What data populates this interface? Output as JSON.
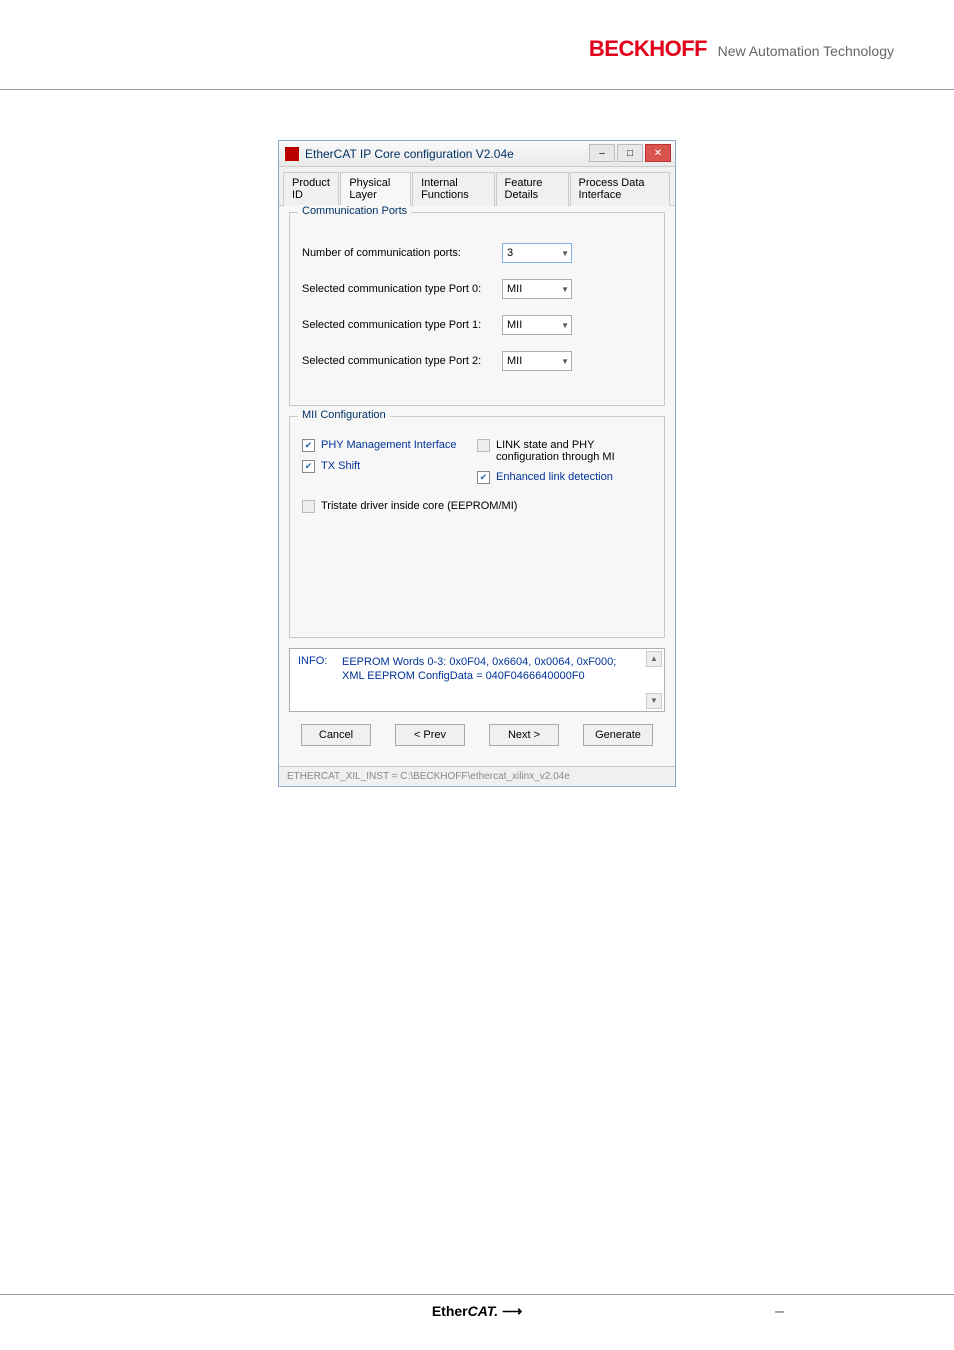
{
  "header": {
    "brand": "BECKHOFF",
    "tagline": "New Automation Technology"
  },
  "dialog": {
    "title": "EtherCAT IP Core configuration V2.04e",
    "window_buttons": {
      "min": "–",
      "max": "□",
      "close": "✕"
    },
    "tabs": [
      "Product ID",
      "Physical Layer",
      "Internal Functions",
      "Feature Details",
      "Process Data Interface"
    ],
    "active_tab": 1,
    "comm_group_title": "Communication Ports",
    "rows": {
      "num_ports_label": "Number of communication ports:",
      "num_ports_value": "3",
      "port0_label": "Selected communication type Port 0:",
      "port0_value": "MII",
      "port1_label": "Selected communication type Port 1:",
      "port1_value": "MII",
      "port2_label": "Selected communication type Port 2:",
      "port2_value": "MII"
    },
    "mii_group_title": "MII Configuration",
    "mii": {
      "phy_mgmt": "PHY Management Interface",
      "link_phy": "LINK state and PHY configuration through MI",
      "tx_shift": "TX Shift",
      "enhanced": "Enhanced link detection",
      "tristate": "Tristate driver inside core (EEPROM/MI)"
    },
    "info": {
      "label": "INFO:",
      "line1": "EEPROM Words 0-3: 0x0F04, 0x6604, 0x0064, 0xF000;",
      "line2": "XML EEPROM ConfigData = 040F0466640000F0"
    },
    "buttons": {
      "cancel": "Cancel",
      "prev": "< Prev",
      "next": "Next >",
      "generate": "Generate"
    },
    "status": "ETHERCAT_XIL_INST =  C:\\BECKHOFF\\ethercat_xilinx_v2.04e"
  },
  "footer": {
    "logo_prefix": "Ether",
    "logo_suffix": "CAT.",
    "dash": "–"
  }
}
